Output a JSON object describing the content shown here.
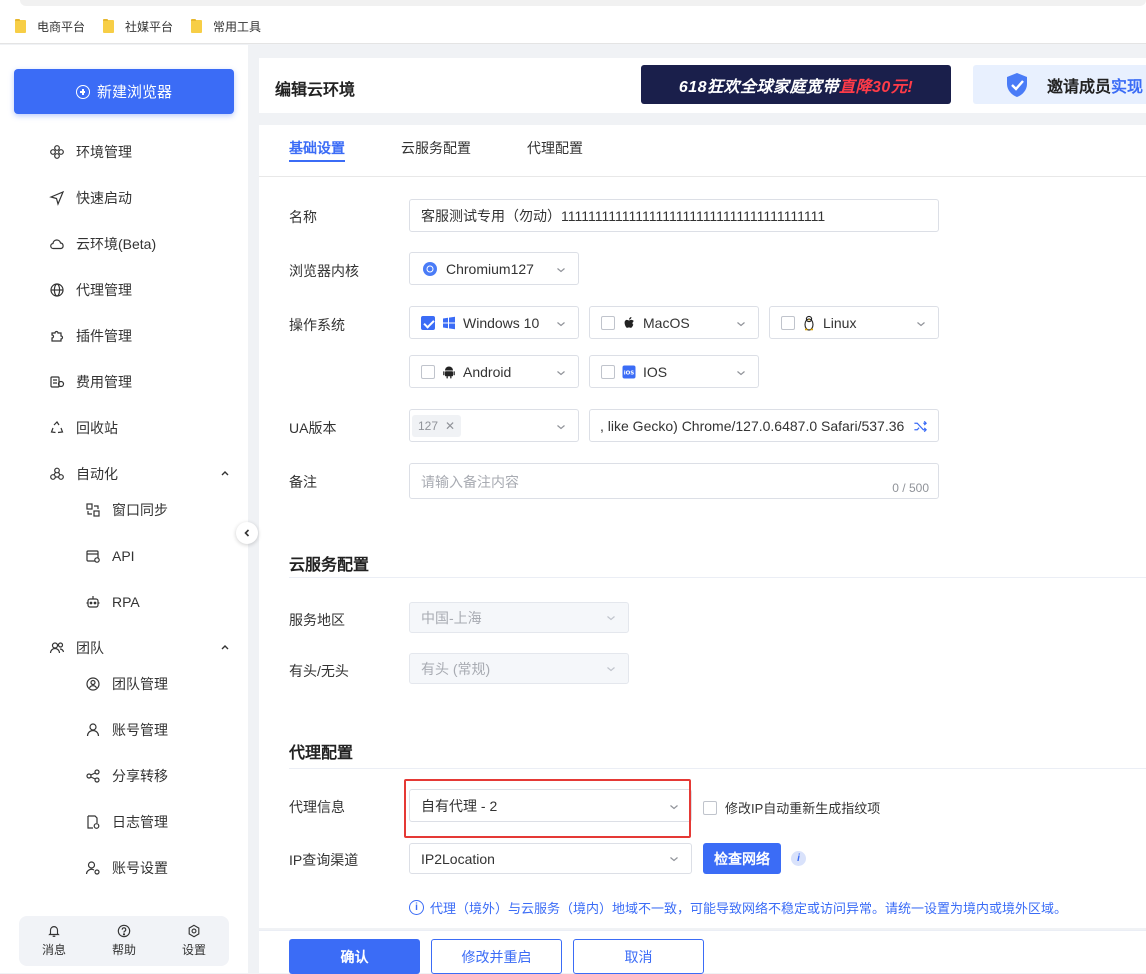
{
  "bookmarks": [
    "电商平台",
    "社媒平台",
    "常用工具"
  ],
  "sidebar": {
    "new_browser": "新建浏览器",
    "items": [
      {
        "label": "环境管理",
        "icon": "environment-icon"
      },
      {
        "label": "快速启动",
        "icon": "send-icon"
      },
      {
        "label": "云环境(Beta)",
        "icon": "cloud-icon"
      },
      {
        "label": "代理管理",
        "icon": "globe-icon"
      },
      {
        "label": "插件管理",
        "icon": "puzzle-icon"
      },
      {
        "label": "费用管理",
        "icon": "billing-icon"
      },
      {
        "label": "回收站",
        "icon": "recycle-icon"
      },
      {
        "label": "自动化",
        "icon": "automation-icon"
      },
      {
        "label": "窗口同步",
        "icon": "window-sync-icon"
      },
      {
        "label": "API",
        "icon": "api-icon"
      },
      {
        "label": "RPA",
        "icon": "robot-icon"
      },
      {
        "label": "团队",
        "icon": "team-icon"
      },
      {
        "label": "团队管理",
        "icon": "team-manage-icon"
      },
      {
        "label": "账号管理",
        "icon": "user-icon"
      },
      {
        "label": "分享转移",
        "icon": "share-icon"
      },
      {
        "label": "日志管理",
        "icon": "log-icon"
      },
      {
        "label": "账号设置",
        "icon": "user-settings-icon"
      }
    ],
    "bottom": [
      {
        "label": "消息",
        "icon": "bell-icon"
      },
      {
        "label": "帮助",
        "icon": "help-icon"
      },
      {
        "label": "设置",
        "icon": "settings-icon"
      }
    ]
  },
  "header": {
    "title": "编辑云环境",
    "banner1_text": "618狂欢全球家庭宽带",
    "banner1_highlight": "直降30元!",
    "banner2_text": "邀请成员",
    "banner2_highlight": "实现"
  },
  "tabs": [
    "基础设置",
    "云服务配置",
    "代理配置"
  ],
  "basic": {
    "name_label": "名称",
    "name_value": "客服测试专用（勿动）111111111111111111111111111111111111111",
    "kernel_label": "浏览器内核",
    "kernel_value": "Chromium127",
    "os_label": "操作系统",
    "os_options": [
      {
        "label": "Windows 10",
        "checked": true,
        "icon": "windows-icon"
      },
      {
        "label": "MacOS",
        "checked": false,
        "icon": "apple-icon"
      },
      {
        "label": "Linux",
        "checked": false,
        "icon": "linux-icon"
      },
      {
        "label": "Android",
        "checked": false,
        "icon": "android-icon"
      },
      {
        "label": "IOS",
        "checked": false,
        "icon": "ios-icon"
      }
    ],
    "ua_label": "UA版本",
    "ua_tag": "127",
    "ua_value": ", like Gecko) Chrome/127.0.6487.0 Safari/537.36",
    "remark_label": "备注",
    "remark_placeholder": "请输入备注内容",
    "remark_count": "0 / 500"
  },
  "cloud": {
    "title": "云服务配置",
    "region_label": "服务地区",
    "region_value": "中国-上海",
    "headless_label": "有头/无头",
    "headless_value": "有头 (常规)"
  },
  "proxy": {
    "title": "代理配置",
    "info_label": "代理信息",
    "info_value": "自有代理 - 2",
    "regen_label": "修改IP自动重新生成指纹项",
    "ip_label": "IP查询渠道",
    "ip_value": "IP2Location",
    "check_button": "检查网络",
    "warning": "代理（境外）与云服务（境内）地域不一致，可能导致网络不稳定或访问异常。请统一设置为境内或境外区域。"
  },
  "footer": {
    "confirm": "确认",
    "save_restart": "修改并重启",
    "cancel": "取消"
  }
}
